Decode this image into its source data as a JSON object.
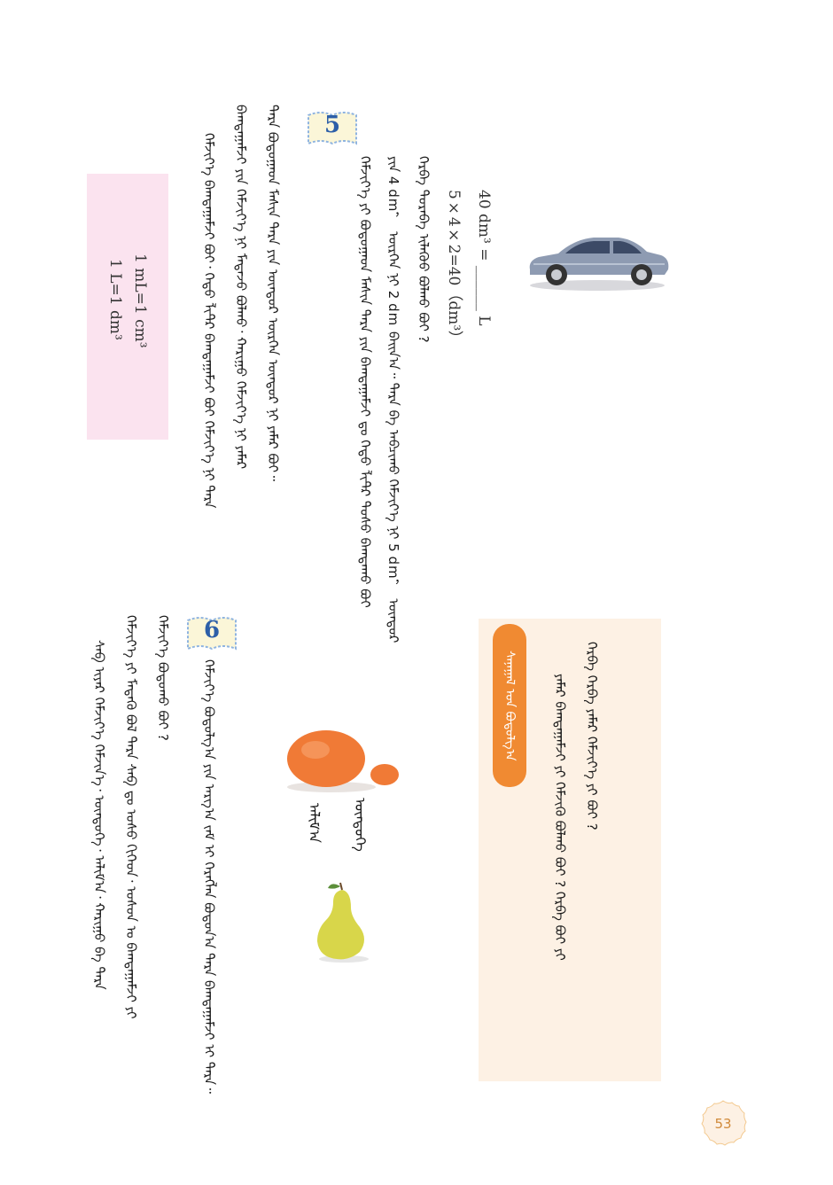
{
  "page_number": "53",
  "problem5": {
    "badge": "5",
    "formula_top": "40 dm³ = ______ L",
    "formula_mid": "5×4×2=40（dm³）",
    "lines": [
      "ᠬᠡᠷᠪᠡ ᠳᠤᠷᠠᠪᠠ ᠢᠯᠡᠭᠦᠦ ᠪᠣᠯᠬᠤ ᠪᠤᠢ ?",
      "ᠶᠢᠨ 4 dm， ᠥᠷᠭᠡᠨ ᠨᠢ 2 dm ᠪᠠᠢᠨ᠎ᠠ᠃ ᠲᠡᠷᠡ ᠪᠡ ᠠᠪᠴᠢᠬᠤ ᠬᠡᠮᠵᠢᠶ᠎ᠡ ᠨᠢ 5 dm， ᠥᠨᠳᠦᠷ",
      "ᠬᠡᠮᠵᠢᠶ᠎ᠡ ᠶᠢ ᠪᠤᠳᠤᠭᠠᠳ ᠮᠠᠰᠢᠨ ᠲᠡᠷᠡ ᠶᠢᠨ ᠪᠠᠭᠲᠠᠭᠠᠮᠵᠢ ᠳᠤ ᠬᠡᠳᠦ ᠯᠢᠲ᠋ᠷ ᠲᠣᠰᠣ ᠪᠠᠭᠲᠠᠬᠤ ᠪᠤᠢ",
      "ᠲᠡᠷᠡ ᠪᠤᠳᠤᠭᠠᠳ ᠮᠠᠰᠢᠨ ᠲᠡᠷᠡ ᠶᠢᠨ ᠥᠨᠳᠦᠷ ᠥᠷᠭᠡᠨ ᠦᠨᠳᠦᠷ ᠨᠢ ᠶᠠᠮᠠᠷ ᠪᠤᠢ᠃",
      "ᠪᠠᠭᠲᠠᠭᠠᠮᠵᠢ ᠶᠢᠨ ᠬᠡᠮᠵᠢᠶ᠎ᠡ ᠨᠢ ᠮᠡᠳᠡᠵᠦ ᠪᠣᠯᠬᠤ᠂ ᠬᠠᠷᠢᠭᠤ ᠬᠡᠮᠵᠢᠶ᠎ᠡ ᠨᠢ ᠶᠠᠮᠠᠷ",
      "ᠬᠡᠮᠵᠢᠶ᠎ᠡ ᠪᠠᠭᠲᠠᠭᠠᠮᠵᠢ ᠪᠤᠢ᠂ ᠬᠡᠳᠦ ᠯᠢᠲ᠋ᠷ ᠪᠠᠭᠲᠠᠭᠠᠮᠵᠢ ᠪᠤᠢ ᠬᠡᠮᠵᠢᠶ᠎ᠡ ᠨᠢ ᠲᠡᠷᠡ"
    ]
  },
  "note_box": {
    "line1": "1 mL=1 cm³",
    "line2": "1 L=1 dm³"
  },
  "problem6": {
    "badge": "6",
    "label_egg": "ᠥᠨᠳᠦᠭᠡ",
    "label_pear": "ᠠᠯᠢᠮ᠎ᠠ",
    "lines": [
      "ᠬᠡᠮᠵᠢᠶ᠎ᠡ ᠪᠣᠳᠤᠯᠭ᠎ᠠ ᠶᠢᠨ ᠠᠷᠭ᠎ᠠ ᠵᠠᠮ ᠢ ᠬᠡᠷᠡᠭᠯᠡᠨ ᠪᠣᠳᠤᠨ᠎ᠠ ᠲᠡᠷᠡ ᠪᠠᠭᠲᠠᠭᠠᠮᠵᠢ ᠢ ᠲᠡᠷᠡ᠃",
      "ᠬᠡᠮᠵᠢᠶ᠎ᠡ ᠪᠣᠳᠤᠬᠤ ᠪᠤᠢ ?",
      "ᠬᠡᠮᠵᠢᠶ᠎ᠡ ᠶᠢ ᠮᠡᠳᠡᠬᠦ ᠪᠣᠯ ᠲᠡᠷᠡ ᠰᠠᠪ ᠳᠤ ᠤᠰᠤ ᠬᠢᠭᠡᠳ᠂ ᠤᠰᠤᠨ ᠤ ᠪᠠᠭᠲᠠᠭᠠᠮᠵᠢ ᠶᠢ",
      "ᠰᠠᠪ ᠢᠶᠠᠷ ᠬᠡᠮᠵᠢᠶ᠎ᠡ ᠬᠡᠮᠵᠢᠨ᠎ᠡ᠂ ᠥᠨᠳᠦᠭᠡ᠂ ᠠᠯᠢᠮ᠎ᠠ᠂ ᠬᠠᠷᠢᠭᠤ ᠪᠠ ᠲᠡᠷᠡ"
    ]
  },
  "think_box": {
    "tag": "ᠰᠠᠨᠠᠭᠠᠯ ᠤᠨ ᠪᠣᠳᠤᠯᠭ᠎ᠠ",
    "line1": "ᠬᠡᠷᠪᠡ ᠬᠡᠷᠪᠡ ᠶᠠᠮᠠᠷ ᠬᠡᠮᠵᠢᠶ᠎ᠡ ᠶᠢ ᠪᠤᠢ ?",
    "line2": "ᠶᠠᠮᠠᠷ ᠪᠠᠭᠲᠠᠭᠠᠮᠵᠢ ᠶᠢ ᠬᠡᠮᠵᠢᠬᠦ ᠪᠣᠯᠬᠤ ᠪᠤᠢ ? ᠬᠡᠷᠪᠡ ᠪᠤᠢ ᠶᠢ"
  },
  "colors": {
    "pink": "#fbe3ef",
    "peach": "#fdf1e4",
    "orange": "#f08a32",
    "badge_blue": "#2d5fa8"
  }
}
